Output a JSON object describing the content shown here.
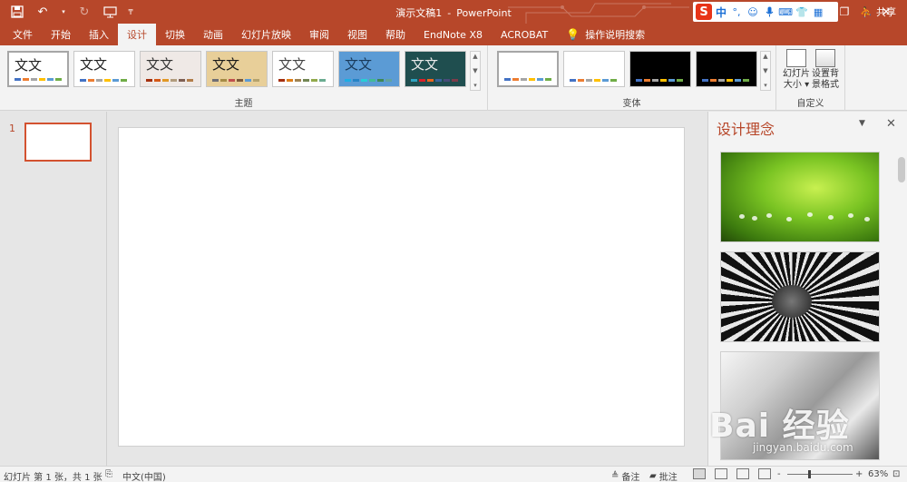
{
  "titlebar": {
    "doc_name": "演示文稿1",
    "separator": "-",
    "app_name": "PowerPoint"
  },
  "qat": {
    "save_icon": "save-icon",
    "undo_icon": "undo-icon",
    "redo_icon": "redo-icon",
    "present_icon": "present-from-start-icon"
  },
  "ime": {
    "logo": "S",
    "mode": "中",
    "punct": "°,"
  },
  "tabs": [
    {
      "label": "文件"
    },
    {
      "label": "开始"
    },
    {
      "label": "插入"
    },
    {
      "label": "设计",
      "active": true
    },
    {
      "label": "切换"
    },
    {
      "label": "动画"
    },
    {
      "label": "幻灯片放映"
    },
    {
      "label": "审阅"
    },
    {
      "label": "视图"
    },
    {
      "label": "帮助"
    },
    {
      "label": "EndNote X8"
    },
    {
      "label": "ACROBAT"
    },
    {
      "label": "操作说明搜索"
    }
  ],
  "share_label": "共享",
  "ribbon": {
    "themes_label": "主题",
    "variants_label": "变体",
    "customize_label": "自定义",
    "theme_sample_text": "文文",
    "slide_size_line1": "幻灯片",
    "slide_size_line2": "大小",
    "format_bg_line1": "设置背",
    "format_bg_line2": "景格式"
  },
  "themes": [
    {
      "bg": "#ffffff",
      "fg": "#222222",
      "bars": [
        "#4472c4",
        "#ed7d31",
        "#a5a5a5",
        "#ffc000",
        "#5b9bd5",
        "#70ad47"
      ]
    },
    {
      "bg": "#ffffff",
      "fg": "#222222",
      "bars": [
        "#4472c4",
        "#ed7d31",
        "#a5a5a5",
        "#ffc000",
        "#5b9bd5",
        "#70ad47"
      ]
    },
    {
      "bg": "#efe9e6",
      "fg": "#333333",
      "bars": [
        "#a5300f",
        "#d55816",
        "#e19825",
        "#b19c7d",
        "#7f5f52",
        "#b27d49"
      ]
    },
    {
      "bg": "#e8cf99",
      "fg": "#1a1a1a",
      "bars": [
        "#6f6f74",
        "#a58b46",
        "#c0504d",
        "#7c5939",
        "#5b9bd5",
        "#b5a36d"
      ]
    },
    {
      "bg": "#ffffff",
      "fg": "#444444",
      "bars": [
        "#a53010",
        "#de7e18",
        "#9f8351",
        "#728653",
        "#92aa4c",
        "#6aac91"
      ]
    },
    {
      "bg": "#5b9bd5",
      "fg": "#1a3a5a",
      "bars": [
        "#1cade4",
        "#2683c6",
        "#27ced7",
        "#42ba97",
        "#3e8853",
        "#62a39f"
      ]
    },
    {
      "bg": "#1f4e4f",
      "fg": "#eaeaea",
      "bars": [
        "#2da2bf",
        "#da1f28",
        "#eb641b",
        "#39639d",
        "#474b78",
        "#7d3c4a"
      ]
    }
  ],
  "variants": [
    {
      "bg": "#ffffff",
      "bars": [
        "#4472c4",
        "#ed7d31",
        "#a5a5a5",
        "#ffc000",
        "#5b9bd5",
        "#70ad47"
      ]
    },
    {
      "bg": "#ffffff",
      "bars": [
        "#4472c4",
        "#ed7d31",
        "#a5a5a5",
        "#ffc000",
        "#5b9bd5",
        "#70ad47"
      ]
    },
    {
      "bg": "#000000",
      "bars": [
        "#4472c4",
        "#ed7d31",
        "#a5a5a5",
        "#ffc000",
        "#5b9bd5",
        "#70ad47"
      ]
    },
    {
      "bg": "#000000",
      "bars": [
        "#4472c4",
        "#ed7d31",
        "#a5a5a5",
        "#ffc000",
        "#5b9bd5",
        "#70ad47"
      ]
    }
  ],
  "thumbnails": {
    "slide_number": "1"
  },
  "design_pane": {
    "title": "设计理念"
  },
  "watermark": {
    "text": "Bai 经验",
    "sub": "jingyan.baidu.com"
  },
  "status": {
    "slide_info": "幻灯片 第 1 张，共 1 张",
    "language": "中文(中国)",
    "notes": "备注",
    "comments": "批注",
    "zoom_minus": "-",
    "zoom_plus": "+",
    "zoom": "63%",
    "zoom_fraction": 0.63
  },
  "colors": {
    "accent": "#b7472a",
    "slide_border": "#d35230"
  }
}
